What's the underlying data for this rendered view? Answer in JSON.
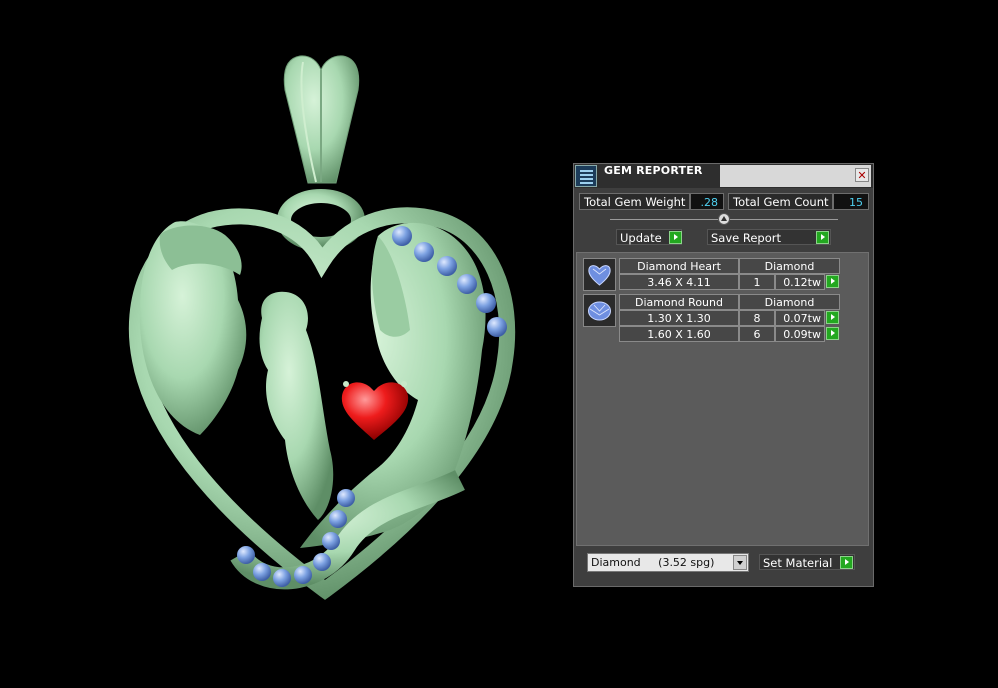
{
  "colors": {
    "background": "#000000",
    "metal": "#a8d8b0",
    "gem_blue": "#6d94d8",
    "heart_red": "#e01010",
    "panel": "#3e3e3e",
    "value_cyan": "#4fd0f0",
    "arrow_green": "#23a820"
  },
  "window": {
    "title": "GEM REPORTER",
    "close_icon": "close-icon"
  },
  "stats": {
    "weight_label": "Total Gem Weight",
    "weight_value": ".28",
    "count_label": "Total Gem Count",
    "count_value": "15"
  },
  "toolbar": {
    "update_label": "Update",
    "save_label": "Save Report"
  },
  "gems": [
    {
      "name": "Diamond Heart",
      "material": "Diamond",
      "icon": "heart-gem-icon",
      "rows": [
        {
          "size": "3.46 X 4.11",
          "count": "1",
          "weight": "0.12tw"
        }
      ]
    },
    {
      "name": "Diamond Round",
      "material": "Diamond",
      "icon": "round-gem-icon",
      "rows": [
        {
          "size": "1.30 X 1.30",
          "count": "8",
          "weight": "0.07tw"
        },
        {
          "size": "1.60 X 1.60",
          "count": "6",
          "weight": "0.09tw"
        }
      ]
    }
  ],
  "footer": {
    "material_value": "Diamond     (3.52 spg)",
    "set_material_label": "Set Material"
  }
}
